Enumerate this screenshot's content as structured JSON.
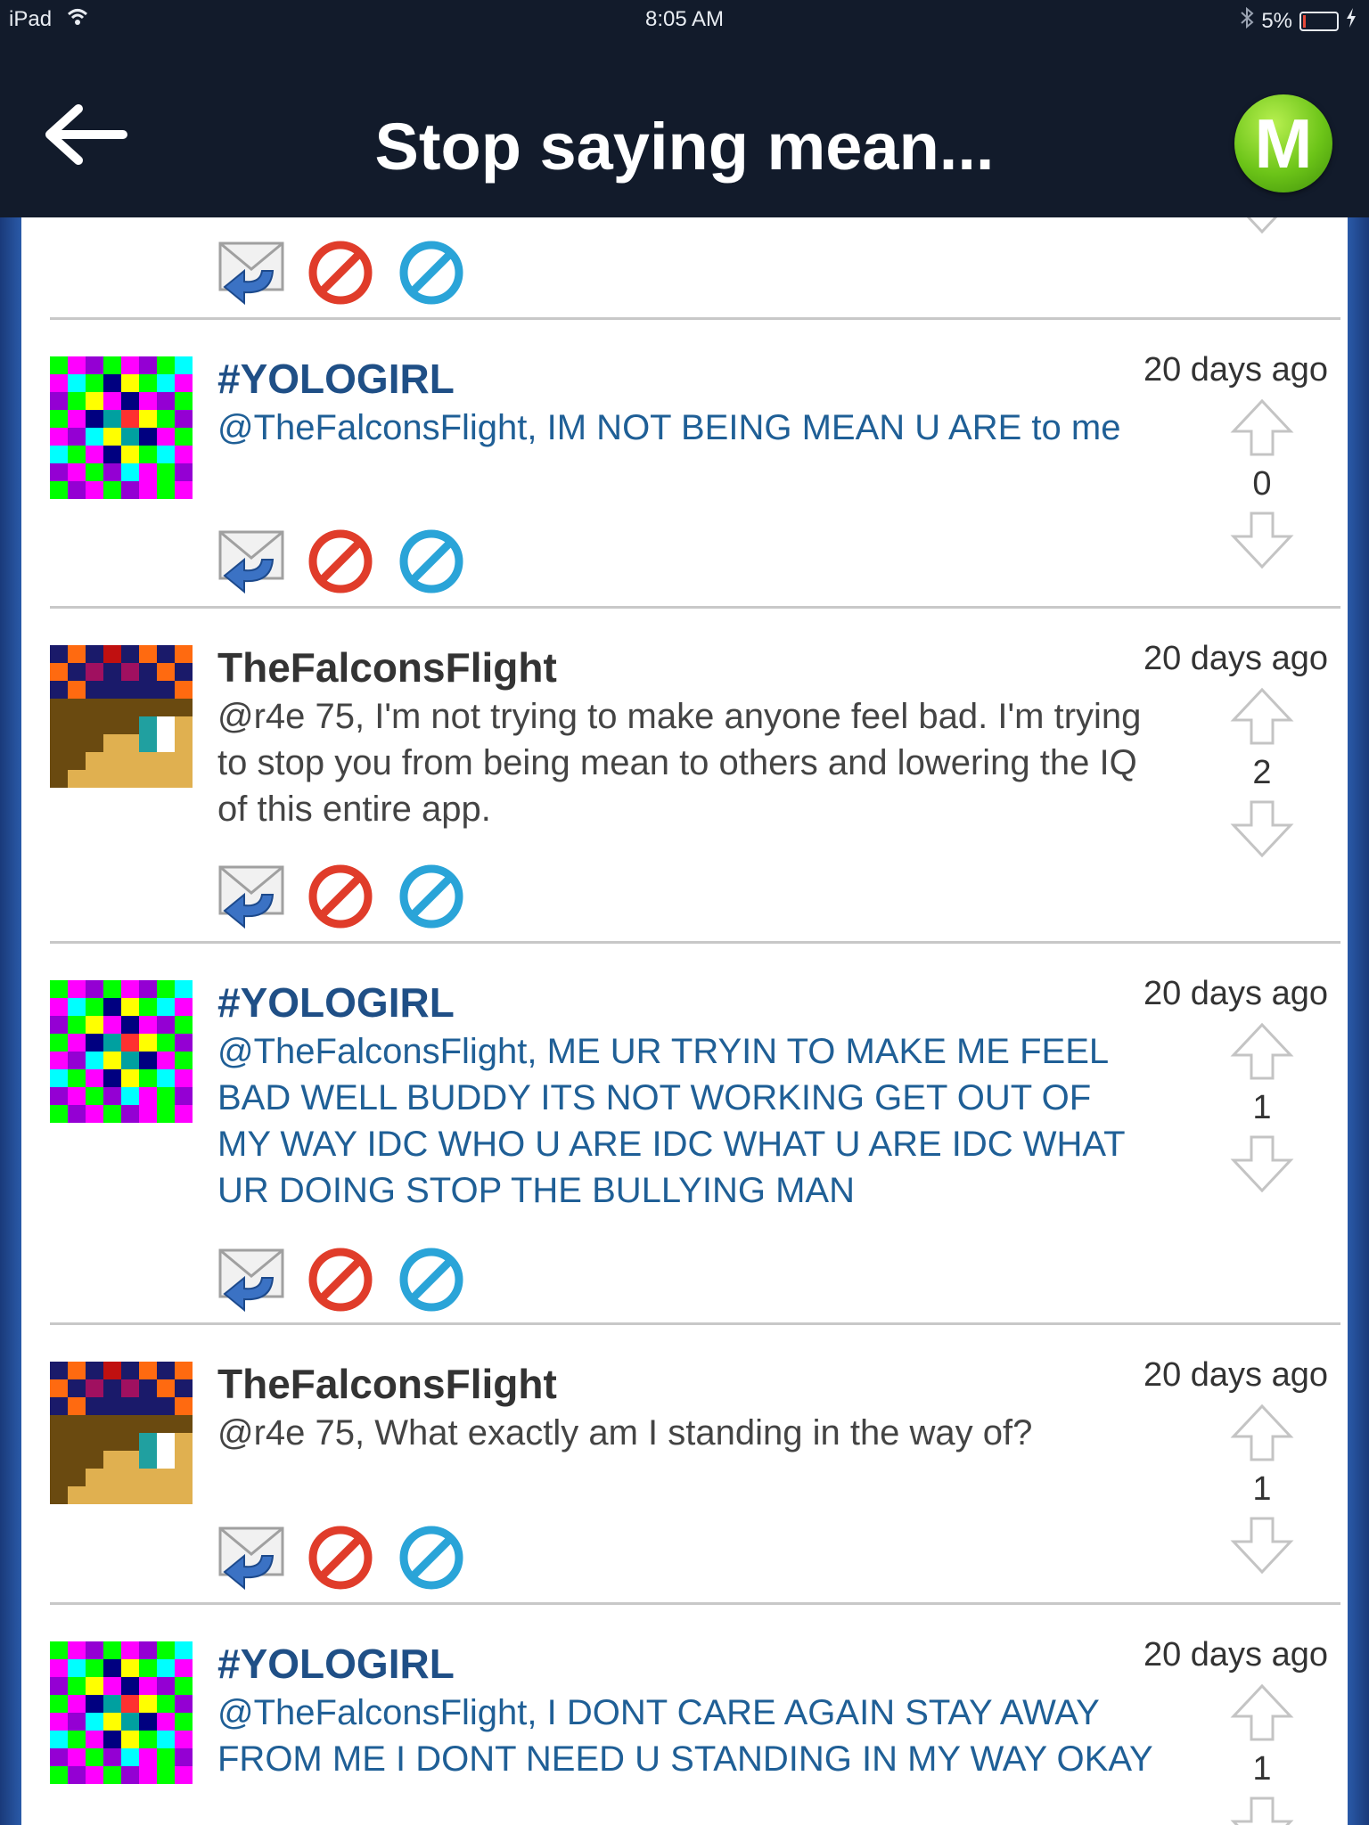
{
  "status_bar": {
    "device": "iPad",
    "time": "8:05 AM",
    "battery": "5%"
  },
  "nav": {
    "title": "Stop saying mean...",
    "logo_letter": "M"
  },
  "colors": {
    "nav_bg": "#121b2b",
    "yolo_name": "#1f4f86",
    "falcon_name": "#333333",
    "logo_green": "#6cc418"
  },
  "posts": [
    {
      "author": "#YOLOGIRL",
      "time": "20 days ago",
      "text": "@TheFalconsFlight, IM NOT BEING MEAN U ARE to me",
      "votes": "0"
    },
    {
      "author": "TheFalconsFlight",
      "time": "20 days ago",
      "text": "@r4e 75, I'm not trying to make anyone feel bad. I'm trying to stop you from being mean to others and lowering the IQ of this entire app.",
      "votes": "2"
    },
    {
      "author": "#YOLOGIRL",
      "time": "20 days ago",
      "text": "@TheFalconsFlight, ME UR TRYIN TO MAKE ME FEEL BAD WELL BUDDY ITS NOT WORKING GET OUT OF MY WAY IDC WHO U ARE IDC WHAT U ARE IDC WHAT UR DOING STOP THE BULLYING MAN",
      "votes": "1"
    },
    {
      "author": "TheFalconsFlight",
      "time": "20 days ago",
      "text": "@r4e 75, What exactly am I standing in the way of?",
      "votes": "1"
    },
    {
      "author": "#YOLOGIRL",
      "time": "20 days ago",
      "text": "@TheFalconsFlight, I DONT CARE AGAIN STAY AWAY FROM ME I DONT NEED U STANDING IN MY WAY OKAY",
      "votes": "1"
    }
  ]
}
